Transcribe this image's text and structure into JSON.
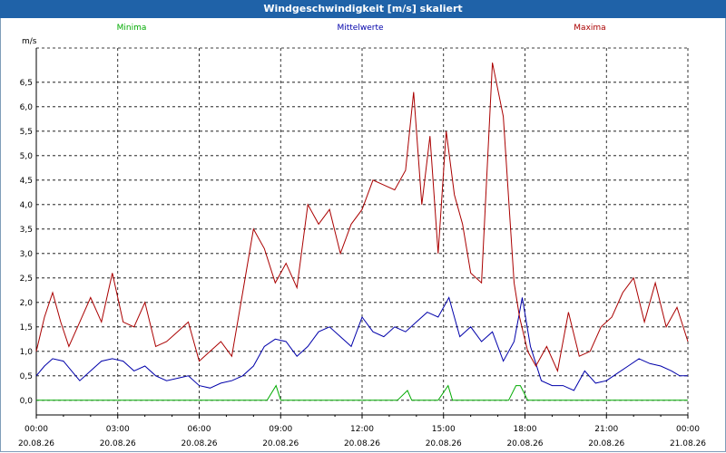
{
  "window": {
    "title": "Windgeschwindigkeit [m/s] skaliert"
  },
  "chart_data": {
    "type": "line",
    "title": "Windgeschwindigkeit [m/s] skaliert",
    "ylabel": "m/s",
    "ylim": [
      -0.3,
      7.2
    ],
    "xlim": [
      0,
      24
    ],
    "grid": true,
    "yticks": [
      0.0,
      0.5,
      1.0,
      1.5,
      2.0,
      2.5,
      3.0,
      3.5,
      4.0,
      4.5,
      5.0,
      5.5,
      6.0,
      6.5
    ],
    "ytick_labels": [
      "0,0",
      "0,5",
      "1,0",
      "1,5",
      "2,0",
      "2,5",
      "3,0",
      "3,5",
      "4,0",
      "4,5",
      "5,0",
      "5,5",
      "6,0",
      "6,5"
    ],
    "xticks": [
      {
        "time": "00:00",
        "date": "20.08.26"
      },
      {
        "time": "03:00",
        "date": "20.08.26"
      },
      {
        "time": "06:00",
        "date": "20.08.26"
      },
      {
        "time": "09:00",
        "date": "20.08.26"
      },
      {
        "time": "12:00",
        "date": "20.08.26"
      },
      {
        "time": "15:00",
        "date": "20.08.26"
      },
      {
        "time": "18:00",
        "date": "20.08.26"
      },
      {
        "time": "21:00",
        "date": "20.08.26"
      },
      {
        "time": "00:00",
        "date": "21.08.26"
      }
    ],
    "legend_position": "top",
    "series": [
      {
        "name": "Minima",
        "color": "#00aa00",
        "x": [
          0,
          8.5,
          8.83,
          9.0,
          13.3,
          13.67,
          13.83,
          14.8,
          15.17,
          15.33,
          17.4,
          17.67,
          17.83,
          18.1,
          24
        ],
        "y": [
          0,
          0,
          0.3,
          0,
          0,
          0.2,
          0,
          0,
          0.3,
          0,
          0,
          0.3,
          0.3,
          0,
          0
        ]
      },
      {
        "name": "Mittelwerte",
        "color": "#0000aa",
        "x": [
          0,
          0.3,
          0.6,
          1.0,
          1.3,
          1.6,
          2.0,
          2.4,
          2.8,
          3.2,
          3.6,
          4.0,
          4.4,
          4.8,
          5.2,
          5.6,
          6.0,
          6.4,
          6.8,
          7.2,
          7.6,
          8.0,
          8.4,
          8.8,
          9.2,
          9.6,
          10.0,
          10.4,
          10.8,
          11.2,
          11.6,
          12.0,
          12.4,
          12.8,
          13.2,
          13.6,
          14.0,
          14.4,
          14.8,
          15.2,
          15.6,
          16.0,
          16.4,
          16.8,
          17.2,
          17.6,
          17.9,
          18.2,
          18.6,
          19.0,
          19.4,
          19.8,
          20.2,
          20.6,
          21.0,
          21.4,
          21.8,
          22.2,
          22.6,
          23.0,
          23.4,
          23.7,
          24.0
        ],
        "y": [
          0.5,
          0.7,
          0.85,
          0.8,
          0.6,
          0.4,
          0.6,
          0.8,
          0.85,
          0.8,
          0.6,
          0.7,
          0.5,
          0.4,
          0.45,
          0.5,
          0.3,
          0.25,
          0.35,
          0.4,
          0.5,
          0.7,
          1.1,
          1.25,
          1.2,
          0.9,
          1.1,
          1.4,
          1.5,
          1.3,
          1.1,
          1.7,
          1.4,
          1.3,
          1.5,
          1.4,
          1.6,
          1.8,
          1.7,
          2.1,
          1.3,
          1.5,
          1.2,
          1.4,
          0.8,
          1.2,
          2.1,
          1.1,
          0.4,
          0.3,
          0.3,
          0.2,
          0.6,
          0.35,
          0.4,
          0.55,
          0.7,
          0.85,
          0.75,
          0.7,
          0.6,
          0.5,
          0.5
        ]
      },
      {
        "name": "Maxima",
        "color": "#aa0000",
        "x": [
          0,
          0.3,
          0.6,
          0.9,
          1.2,
          1.6,
          2.0,
          2.4,
          2.8,
          3.2,
          3.6,
          4.0,
          4.4,
          4.8,
          5.2,
          5.6,
          6.0,
          6.4,
          6.8,
          7.2,
          7.6,
          8.0,
          8.4,
          8.8,
          9.2,
          9.6,
          10.0,
          10.4,
          10.8,
          11.2,
          11.6,
          12.0,
          12.4,
          12.8,
          13.2,
          13.6,
          13.9,
          14.2,
          14.5,
          14.8,
          15.1,
          15.4,
          15.7,
          16.0,
          16.4,
          16.8,
          17.2,
          17.6,
          17.8,
          18.1,
          18.4,
          18.8,
          19.2,
          19.6,
          20.0,
          20.4,
          20.8,
          21.2,
          21.6,
          22.0,
          22.4,
          22.8,
          23.2,
          23.6,
          24.0
        ],
        "y": [
          1.0,
          1.7,
          2.2,
          1.6,
          1.1,
          1.6,
          2.1,
          1.6,
          2.6,
          1.6,
          1.5,
          2.0,
          1.1,
          1.2,
          1.4,
          1.6,
          0.8,
          1.0,
          1.2,
          0.9,
          2.2,
          3.5,
          3.1,
          2.4,
          2.8,
          2.3,
          4.0,
          3.6,
          3.9,
          3.0,
          3.6,
          3.9,
          4.5,
          4.4,
          4.3,
          4.7,
          6.3,
          4.0,
          5.4,
          3.0,
          5.5,
          4.2,
          3.6,
          2.6,
          2.4,
          6.9,
          5.8,
          2.4,
          1.7,
          1.0,
          0.7,
          1.1,
          0.6,
          1.8,
          0.9,
          1.0,
          1.5,
          1.7,
          2.2,
          2.5,
          1.6,
          2.4,
          1.5,
          1.9,
          1.2
        ]
      }
    ]
  }
}
